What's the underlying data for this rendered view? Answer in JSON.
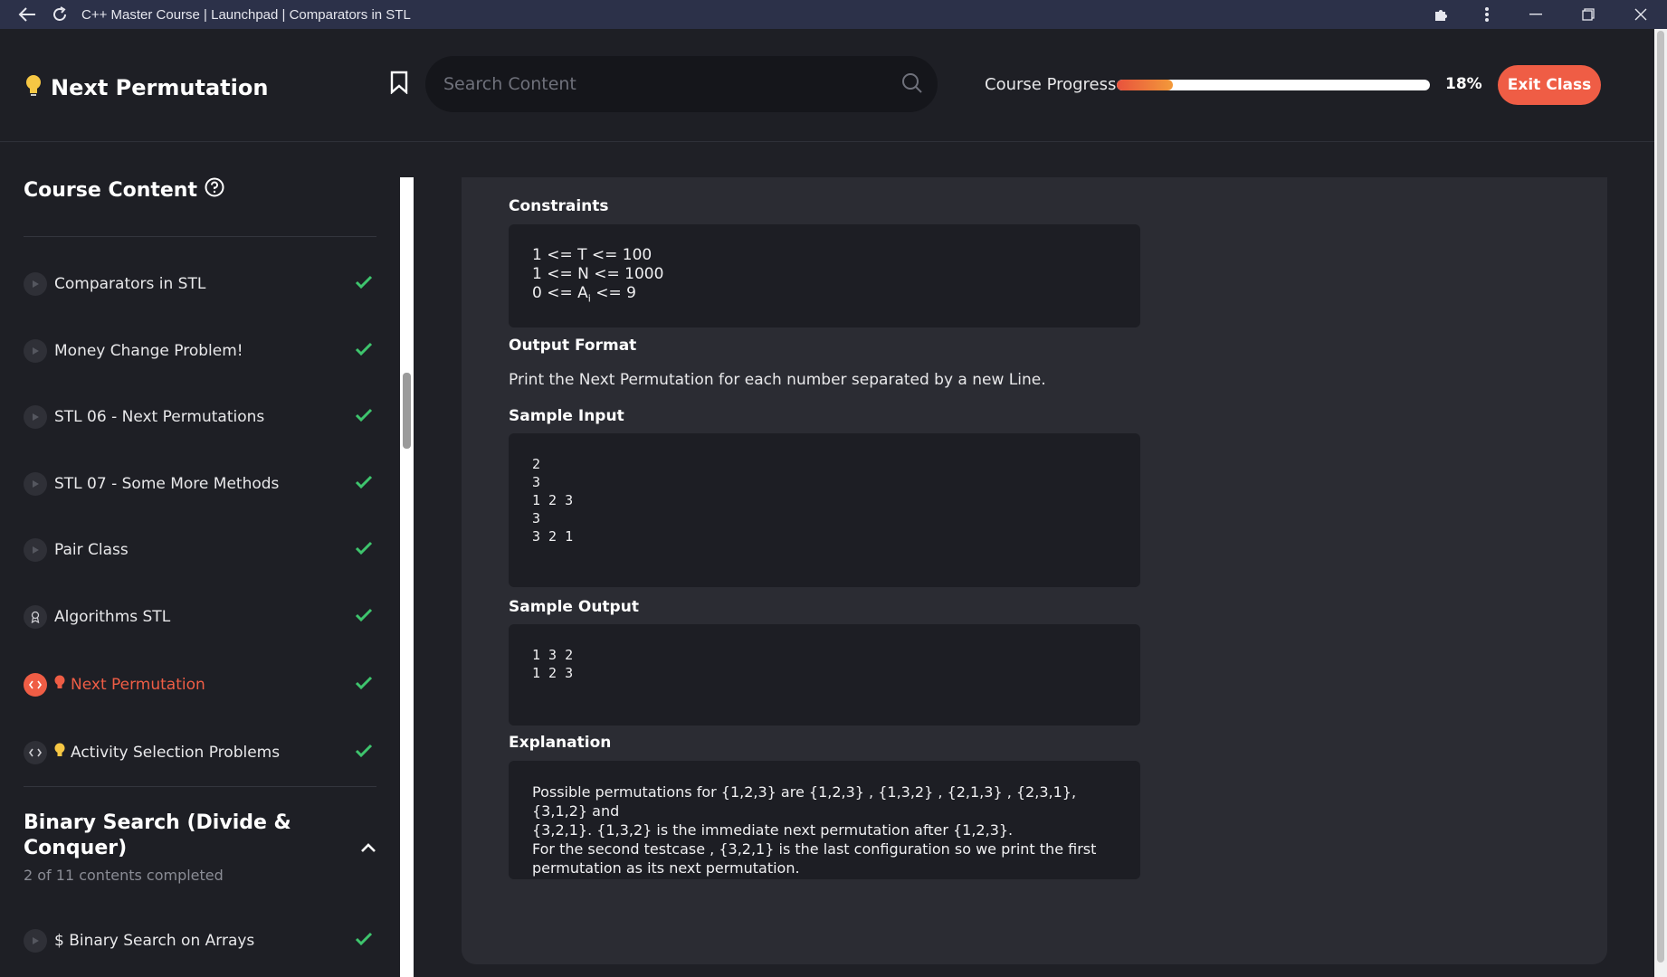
{
  "window": {
    "title": "C++ Master Course | Launchpad | Comparators in STL"
  },
  "header": {
    "page_title": "Next Permutation",
    "search_placeholder": "Search Content",
    "progress_label": "Course Progress",
    "progress_value": 0.18,
    "progress_text": "18%",
    "exit_label": "Exit Class"
  },
  "colors": {
    "accent": "#ef5d45",
    "check": "#3ec46d",
    "bulb": "#f6c744"
  },
  "sidebar": {
    "title": "Course Content",
    "items": [
      {
        "label": "Comparators in STL",
        "icon": "play-icon"
      },
      {
        "label": "Money Change Problem!",
        "icon": "play-icon"
      },
      {
        "label": "STL 06 - Next Permutations",
        "icon": "play-icon"
      },
      {
        "label": "STL 07 - Some More Methods",
        "icon": "play-icon"
      },
      {
        "label": "Pair Class",
        "icon": "play-icon"
      },
      {
        "label": "Algorithms STL",
        "icon": "award-icon"
      },
      {
        "label": "Next Permutation",
        "icon": "code-icon",
        "active": true
      },
      {
        "label": "Activity Selection Problems",
        "icon": "code-icon"
      }
    ],
    "section": {
      "title": "Binary Search (Divide & Conquer)",
      "subtitle": "2 of 11 contents completed",
      "first_item": "$ Binary Search on Arrays"
    }
  },
  "content": {
    "constraints_heading": "Constraints",
    "constraints": [
      "1 <= T <= 100",
      "1 <= N <= 1000",
      "0 <= A",
      "i",
      " <= 9"
    ],
    "output_heading": "Output Format",
    "output_text": "Print the Next Permutation for each number separated by a new Line.",
    "sample_input_heading": "Sample Input",
    "sample_input": "2\n3\n1 2 3\n3\n3 2 1",
    "sample_output_heading": "Sample Output",
    "sample_output": "1 3 2\n1 2 3",
    "explanation_heading": "Explanation",
    "explanation_lines": [
      "Possible permutations for {1,2,3} are {1,2,3} , {1,3,2} , {2,1,3} , {2,3,1}, {3,1,2} and",
      "{3,2,1}. {1,3,2} is the immediate next permutation after {1,2,3}.",
      "For the second testcase , {3,2,1} is the last configuration so we print the first",
      "permutation as its next permutation."
    ]
  }
}
